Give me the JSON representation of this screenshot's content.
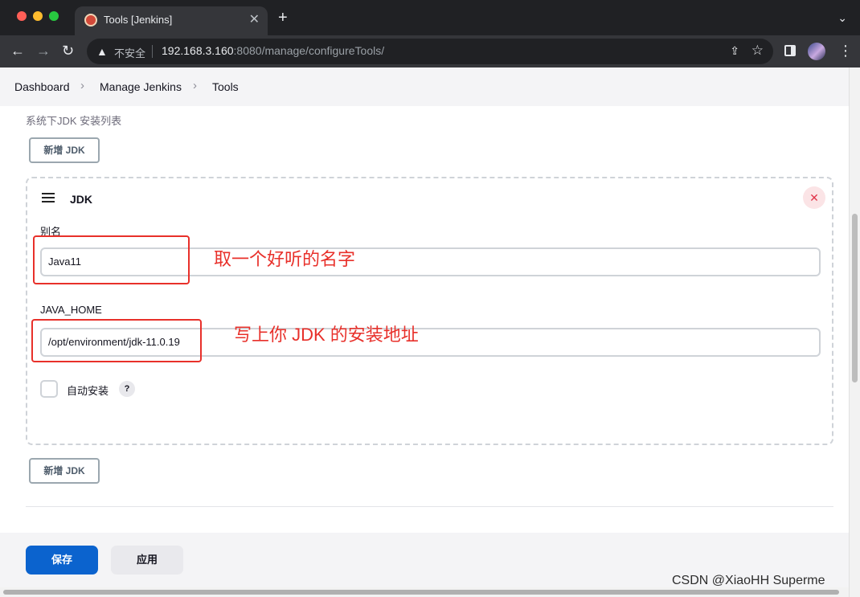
{
  "browser": {
    "tab_title": "Tools [Jenkins]",
    "tab_close": "✕",
    "new_tab": "+",
    "tab_menu": "⌄",
    "nav_back": "←",
    "nav_forward": "→",
    "nav_reload": "↻",
    "security_label": "不安全",
    "url_host": "192.168.3.160",
    "url_path": ":8080/manage/configureTools/",
    "more_icon": "⋮"
  },
  "breadcrumbs": {
    "items": [
      "Dashboard",
      "Manage Jenkins",
      "Tools"
    ],
    "separator": "›"
  },
  "jdk_section": {
    "description": "系统下JDK 安装列表",
    "add_button": "新增 JDK",
    "card": {
      "title": "JDK",
      "remove_glyph": "✕",
      "alias_label": "别名",
      "alias_value": "Java11",
      "java_home_label": "JAVA_HOME",
      "java_home_value": "/opt/environment/jdk-11.0.19",
      "auto_install_label": "自动安装",
      "help_glyph": "?"
    }
  },
  "annotations": {
    "alias_note": "取一个好听的名字",
    "java_home_note": "写上你 JDK 的安装地址"
  },
  "footer": {
    "save_label": "保存",
    "apply_label": "应用"
  },
  "watermark": "CSDN @XiaoHH Superme",
  "colors": {
    "primary": "#0b63ce",
    "annotation": "#e8302a",
    "danger": "#e0344a"
  }
}
